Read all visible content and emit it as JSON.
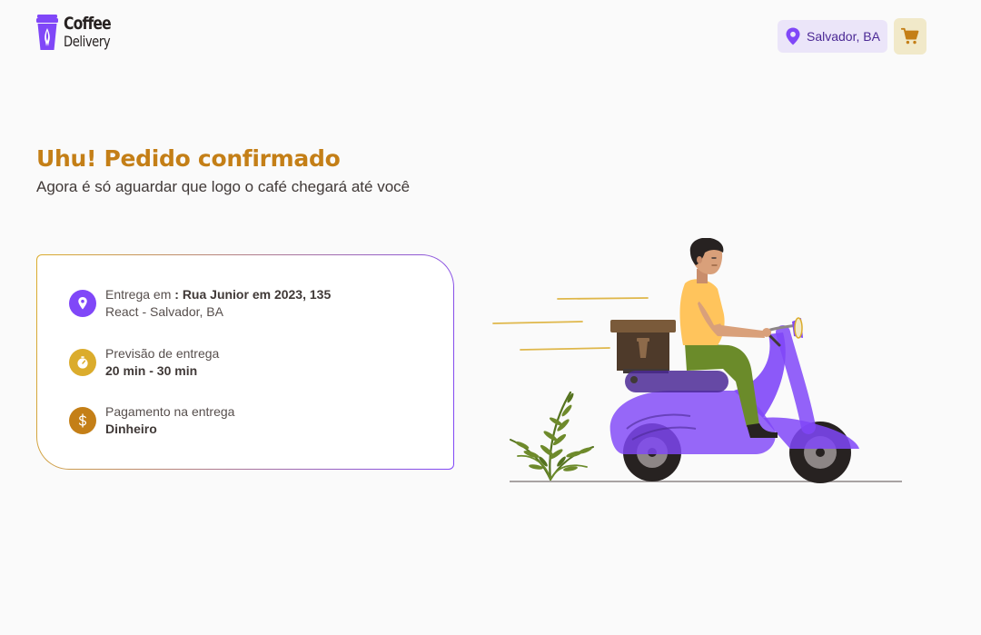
{
  "header": {
    "logo": {
      "line1": "Coffee",
      "line2": "Delivery",
      "icon": "coffee-cup-logo"
    },
    "location": {
      "text": "Salvador, BA",
      "icon": "map-pin-icon"
    },
    "cart": {
      "icon": "shopping-cart-icon"
    }
  },
  "main": {
    "title": "Uhu! Pedido confirmado",
    "subtitle": "Agora é só aguardar que logo o café chegará até você"
  },
  "order_info": {
    "delivery": {
      "icon": "map-pin-icon",
      "label": "Entrega em ",
      "address": ": Rua Junior em 2023, 135",
      "city": "React - Salvador, BA"
    },
    "eta": {
      "icon": "timer-icon",
      "label": "Previsão de entrega",
      "value": "20 min - 30 min"
    },
    "payment": {
      "icon": "dollar-icon",
      "label": "Pagamento na entrega",
      "value": "Dinheiro"
    }
  },
  "illustration": {
    "subject": "delivery-person-on-scooter"
  },
  "colors": {
    "background": "#FAFAFA",
    "brand_purple": "#8047F8",
    "purple_dark": "#4B2995",
    "purple_light": "#EBE5F9",
    "yellow": "#DBAC2C",
    "yellow_dark": "#C47F17",
    "yellow_light": "#F1E9C9",
    "text": "#403937"
  }
}
